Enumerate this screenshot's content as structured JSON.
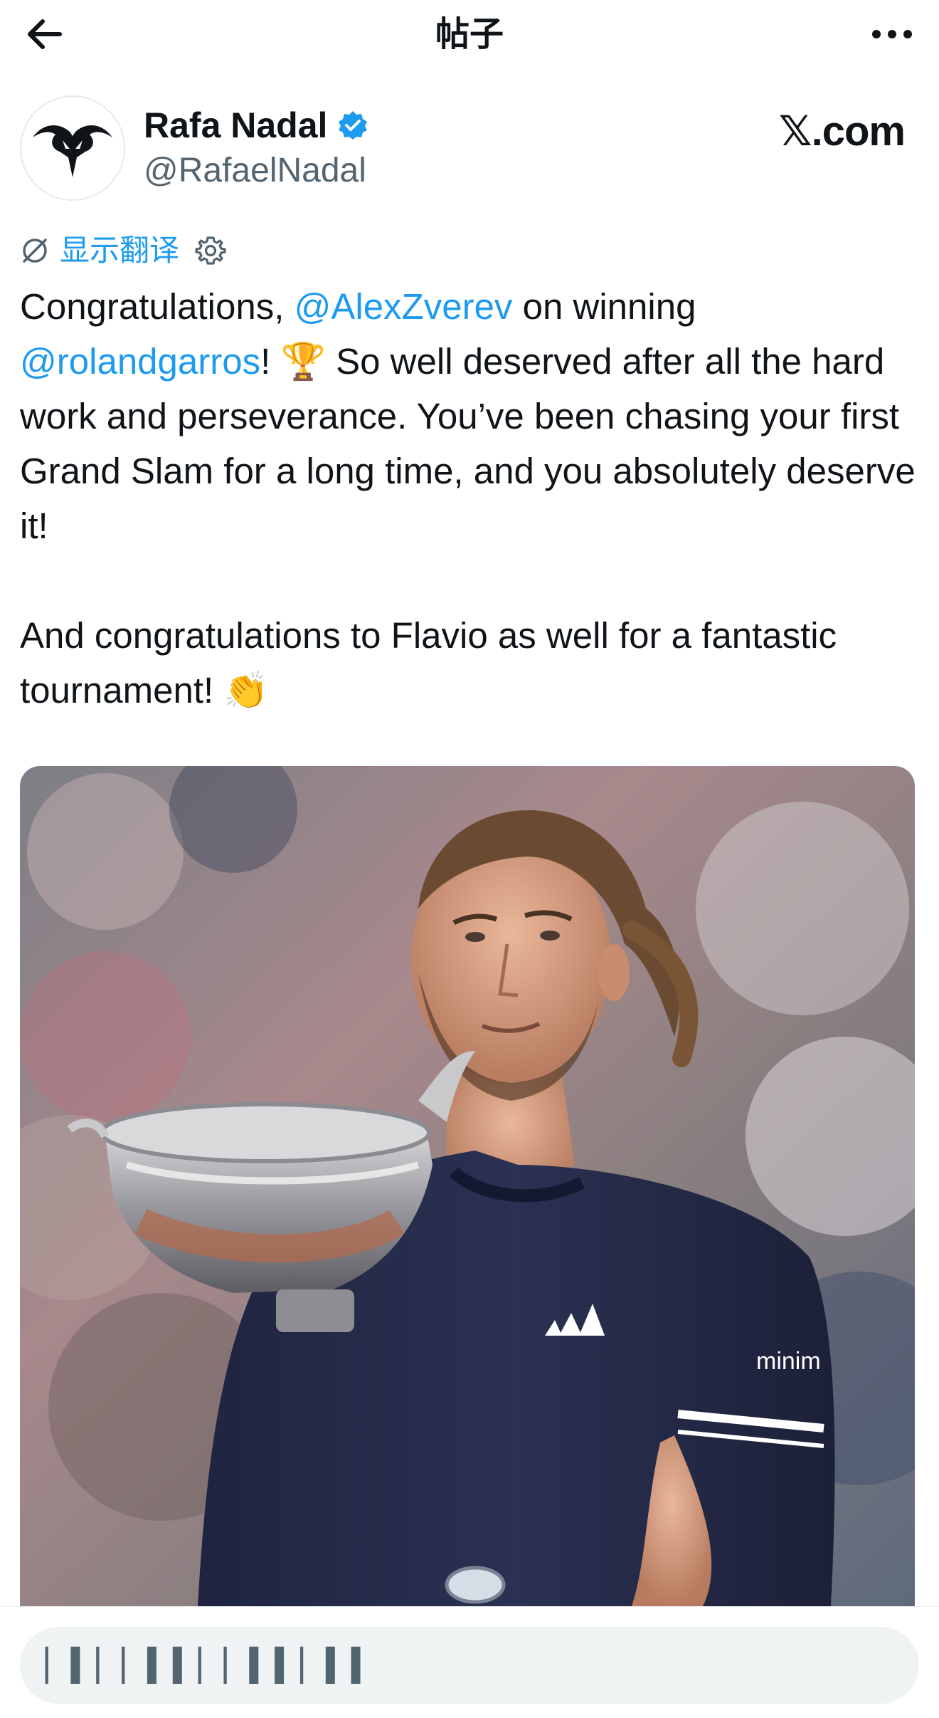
{
  "header": {
    "title": "帖子",
    "back_icon": "arrow-left-icon",
    "more_icon": "more-horizontal-icon"
  },
  "author": {
    "display_name": "Rafa Nadal",
    "handle": "@RafaelNadal",
    "verified": true,
    "avatar_icon": "bull-logo-icon"
  },
  "brand": "𝕏.com",
  "translate": {
    "label": "显示翻译",
    "icon": "translate-icon",
    "settings_icon": "gear-icon"
  },
  "tweet": {
    "p1_prefix": "Congratulations, ",
    "mention1": "@AlexZverev",
    "p1_mid": "  on winning ",
    "mention2": "@rolandgarros",
    "p1_suffix": "! 🏆 So well deserved after all the hard work and perseverance. You’ve been chasing your first Grand Slam for a long time, and you absolutely deserve it!",
    "p2": "And congratulations to Flavio as well for a fantastic tournament! 👏"
  },
  "media": {
    "description_icon": "photo-trophy-player",
    "shirt_logo_text": "minim"
  },
  "reply": {
    "placeholder": "▏▍▏▏▍▍▏▏▍▍▏▍▍"
  },
  "colors": {
    "link": "#1d9bf0",
    "text": "#0f1419",
    "secondary": "#536471",
    "verified": "#1d9bf0"
  }
}
